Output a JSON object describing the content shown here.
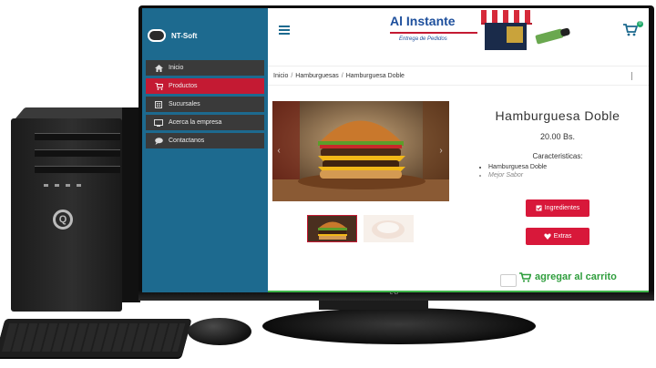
{
  "sidebar": {
    "brand": "NT-Soft",
    "items": [
      {
        "label": "Inicio",
        "icon": "home-icon"
      },
      {
        "label": "Productos",
        "icon": "cart-icon",
        "active": true
      },
      {
        "label": "Sucursales",
        "icon": "building-icon"
      },
      {
        "label": "Acerca la empresa",
        "icon": "info-icon"
      },
      {
        "label": "Contactanos",
        "icon": "chat-icon"
      }
    ]
  },
  "header": {
    "menu_icon": "hamburger-icon",
    "logo_title": "Al Instante",
    "logo_subtitle": "Entrega de Pedidos",
    "cart_icon": "cart-icon",
    "cart_count": "0"
  },
  "breadcrumb": [
    "Inicio",
    "Hamburguesas",
    "Hamburguesa Doble"
  ],
  "product": {
    "name": "Hamburguesa Doble",
    "price": "20.00 Bs.",
    "features_title": "Caracteristicas:",
    "features": [
      "Hamburguesa Doble",
      "Mejor Sabor"
    ],
    "ingredients_label": "Ingredientes",
    "extras_label": "Extras",
    "add_to_cart_label": "agregar al carrito"
  },
  "colors": {
    "sidebar": "#1d6a8f",
    "accent_red": "#d8183a",
    "brand_blue": "#1d4f9c",
    "add_green": "#2f9e3d"
  }
}
